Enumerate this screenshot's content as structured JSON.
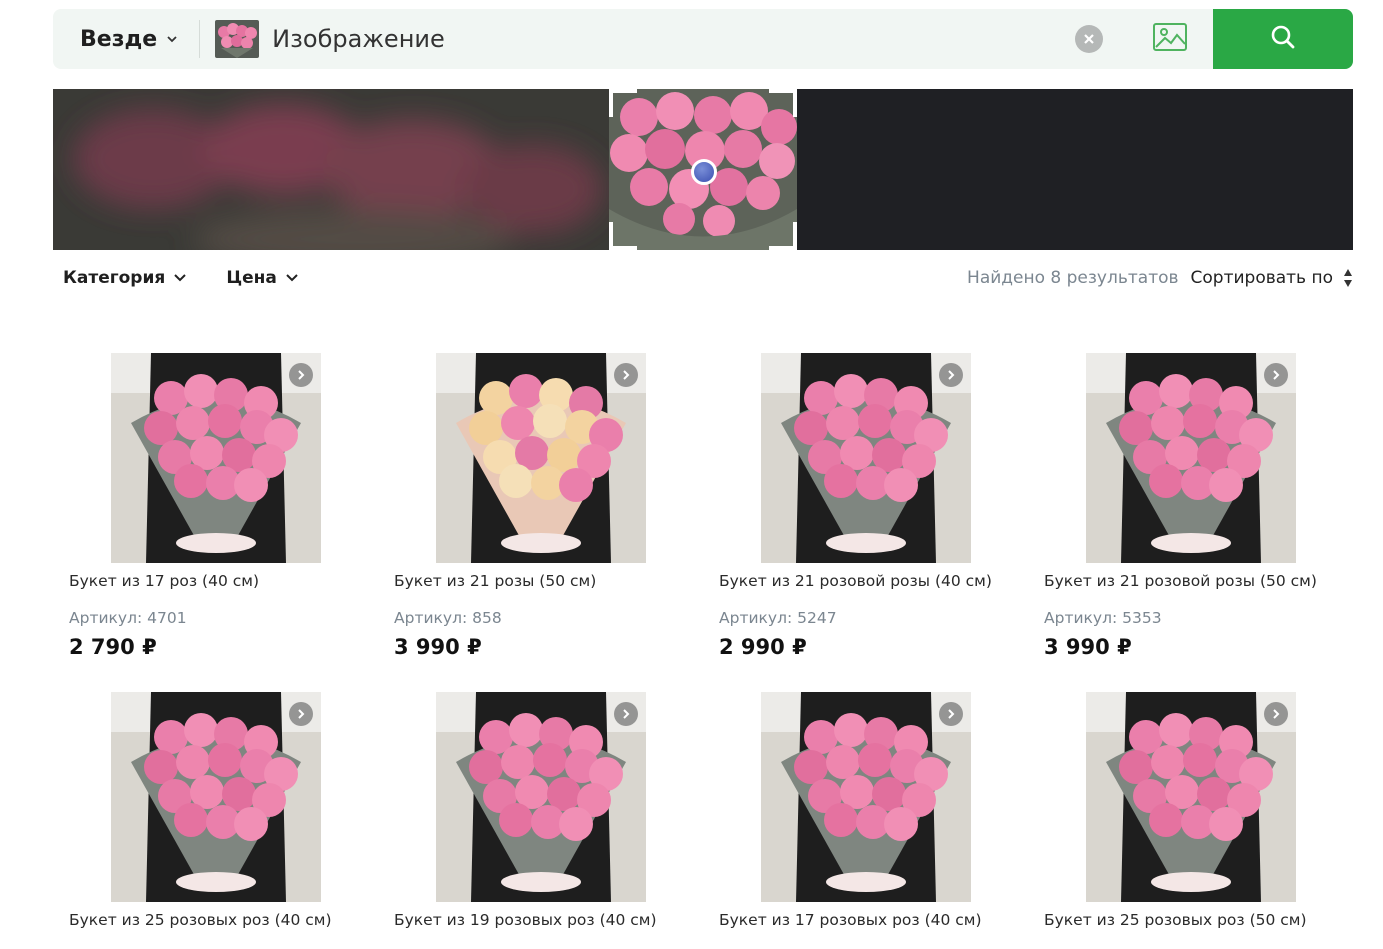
{
  "search": {
    "scope_label": "Везде",
    "query_label": "Изображение",
    "colors": {
      "button": "#2aa845",
      "bar": "#f1f6f3"
    }
  },
  "icons": {
    "scope": "chevron-down-icon",
    "clear": "close-circle-icon",
    "image_search": "image-icon",
    "search": "search-icon"
  },
  "filters": [
    {
      "label": "Категория"
    },
    {
      "label": "Цена"
    }
  ],
  "results": {
    "found_text": "Найдено 8 результатов",
    "sort_label": "Сортировать по"
  },
  "products": [
    {
      "title": "Букет из 17 роз (40 см)",
      "sku": "Артикул: 4701",
      "price": "2 790 ₽",
      "style": "pink"
    },
    {
      "title": "Букет из 21 розы (50 см)",
      "sku": "Артикул: 858",
      "price": "3 990 ₽",
      "style": "mixed"
    },
    {
      "title": "Букет из 21 розовой розы (40 см)",
      "sku": "Артикул: 5247",
      "price": "2 990 ₽",
      "style": "pink"
    },
    {
      "title": "Букет из 21 розовой розы (50 см)",
      "sku": "Артикул: 5353",
      "price": "3 990 ₽",
      "style": "pink"
    },
    {
      "title": "Букет из 25 розовых роз (40 см)",
      "sku": "",
      "price": "",
      "style": "pink"
    },
    {
      "title": "Букет из 19 розовых роз (40 см)",
      "sku": "",
      "price": "",
      "style": "pink"
    },
    {
      "title": "Букет из 17 розовых роз (40 см)",
      "sku": "",
      "price": "",
      "style": "pink"
    },
    {
      "title": "Букет из 25 розовых роз (50 см)",
      "sku": "",
      "price": "",
      "style": "pink"
    }
  ]
}
